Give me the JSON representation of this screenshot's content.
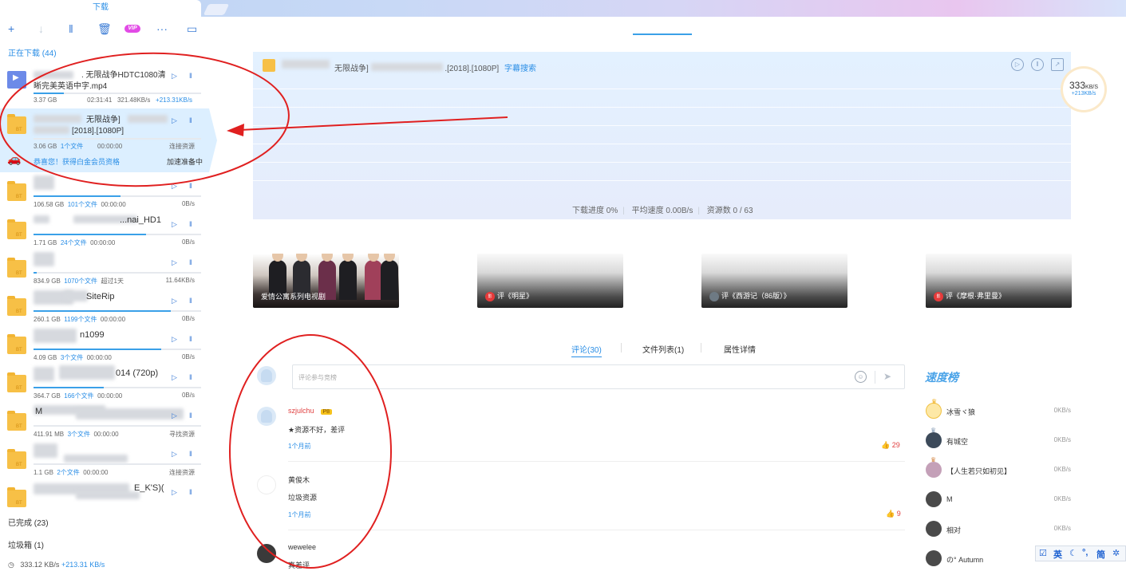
{
  "window": {
    "active_tab": "下载"
  },
  "toolbar": {
    "vip_label": "VIP"
  },
  "sidebar": {
    "downloading_label": "正在下载 (44)",
    "done_label": "已完成 (23)",
    "trash_label": "垃圾箱 (1)",
    "speed_total": "333.12 KB/s",
    "speed_boost": "+213.31 KB/s",
    "items": [
      {
        "name_line1": ". 无限战争HDTC1080清",
        "name_line2": "晰完美英语中字.mp4",
        "size": "3.37 GB",
        "time": "02:31:41",
        "speed": "321.48KB/s",
        "boost": "+213.31KB/s",
        "progress": 0.18,
        "type": "video"
      },
      {
        "name_line1": "无限战争]",
        "name_line2": "[2018].[1080P]",
        "size": "3.06 GB",
        "files": "1个文件",
        "time": "00:00:00",
        "status": "连接资源",
        "progress": 0.0,
        "promo": "恭喜您！获得白金会员资格",
        "promo_status": "加速准备中",
        "type": "bt"
      },
      {
        "name_line1": "",
        "size": "106.58 GB",
        "files": "101个文件",
        "time": "00:00:00",
        "status": "0B/s",
        "progress": 0.52,
        "type": "bt"
      },
      {
        "name_line1": "...nai_HD1",
        "size": "1.71 GB",
        "files": "24个文件",
        "time": "00:00:00",
        "status": "0B/s",
        "progress": 0.67,
        "type": "bt"
      },
      {
        "name_line1": "",
        "size": "834.9 GB",
        "files": "1070个文件",
        "time": "超过1天",
        "status": "11.64KB/s",
        "progress": 0.02,
        "type": "bt"
      },
      {
        "name_line1": "SiteRip",
        "size": "260.1 GB",
        "files": "1199个文件",
        "time": "00:00:00",
        "status": "0B/s",
        "progress": 0.82,
        "type": "bt"
      },
      {
        "name_line1": "n1099",
        "size": "4.09 GB",
        "files": "3个文件",
        "time": "00:00:00",
        "status": "0B/s",
        "progress": 0.76,
        "type": "bt"
      },
      {
        "name_line1": "014 (720p)",
        "size": "364.7 GB",
        "files": "166个文件",
        "time": "00:00:00",
        "status": "0B/s",
        "progress": 0.42,
        "type": "bt"
      },
      {
        "name_line1": "M",
        "size": "411.91 MB",
        "files": "3个文件",
        "time": "00:00:00",
        "status": "寻找资源",
        "progress": 0.0,
        "type": "bt"
      },
      {
        "name_line1": "",
        "size": "1.1 GB",
        "files": "2个文件",
        "time": "00:00:00",
        "status": "连接资源",
        "progress": 0.0,
        "type": "bt"
      },
      {
        "name_line1": "E_K'S)(",
        "size": "",
        "files": "",
        "time": "",
        "status": "",
        "progress": 0.0,
        "type": "bt"
      }
    ]
  },
  "task": {
    "title": "无限战争]",
    "title_tail": ".[2018].[1080P]",
    "subtitle_link": "字幕搜索",
    "progress_label": "下载进度 0%",
    "avg_speed_label": "平均速度 0.00B/s",
    "sources_label": "资源数 0 / 63"
  },
  "speed_bubble": {
    "value": "333",
    "unit": "KB/S",
    "boost": "+213KB/s"
  },
  "cards": [
    {
      "caption": "爱情公寓系列电视剧"
    },
    {
      "caption": "评《明星》"
    },
    {
      "caption": "评《西游记（86版）》"
    },
    {
      "caption": "评《摩根·弗里曼》"
    }
  ],
  "comment_tabs": {
    "comments": "评论(30)",
    "files": "文件列表(1)",
    "props": "属性详情"
  },
  "comment_input": {
    "placeholder": "评论参与竞榜"
  },
  "comments": [
    {
      "user": "szjulchu",
      "badge": "P8",
      "text": "★资源不好，差评",
      "time": "1个月前",
      "likes": "29"
    },
    {
      "user": "黄俊木",
      "text": "垃圾资源",
      "time": "1个月前",
      "likes": "9"
    },
    {
      "user": "wewelee",
      "text": "真差评"
    }
  ],
  "board": {
    "title": "速度榜",
    "rows": [
      {
        "name": "冰雪ヾ狼",
        "speed": "0KB/s",
        "medal": "gold"
      },
      {
        "name": "有城空",
        "speed": "0KB/s",
        "medal": "silver"
      },
      {
        "name": "【人生若只如初见】",
        "speed": "0KB/s",
        "medal": "bronze"
      },
      {
        "name": "M",
        "speed": "0KB/s",
        "medal": "gray"
      },
      {
        "name": "相对",
        "speed": "0KB/s",
        "medal": "gray"
      },
      {
        "name": "の° Autumn",
        "speed": "",
        "medal": "gray"
      }
    ]
  },
  "ime": {
    "lang": "英",
    "mode": "简"
  },
  "colors": {
    "accent": "#2a8ee6",
    "annotation": "#e02020",
    "folder": "#f7c046"
  }
}
